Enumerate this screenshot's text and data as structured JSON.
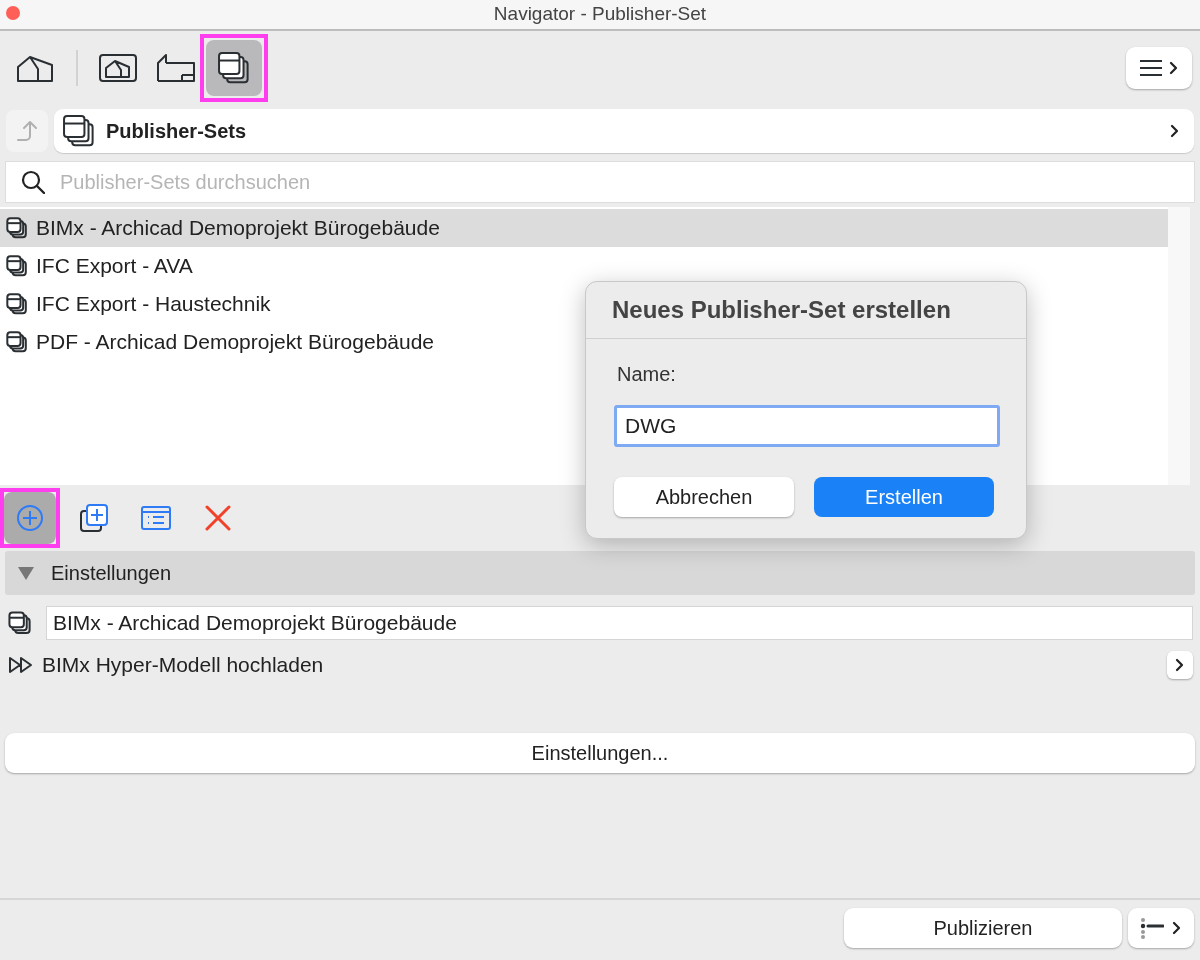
{
  "window": {
    "title": "Navigator - Publisher-Set"
  },
  "view_tabs": [
    {
      "kind": "project",
      "selected": false,
      "highlighted": false
    },
    {
      "kind": "view",
      "selected": false,
      "highlighted": false
    },
    {
      "kind": "layout",
      "selected": false,
      "highlighted": false
    },
    {
      "kind": "publisher",
      "selected": true,
      "highlighted": true
    }
  ],
  "path_bar": {
    "title": "Publisher-Sets"
  },
  "search": {
    "placeholder": "Publisher-Sets durchsuchen"
  },
  "sets": [
    {
      "label": "BIMx - Archicad Demoprojekt Bürogebäude",
      "selected": true
    },
    {
      "label": "IFC Export - AVA",
      "selected": false
    },
    {
      "label": "IFC Export - Haustechnik",
      "selected": false
    },
    {
      "label": "PDF - Archicad Demoprojekt Bürogebäude",
      "selected": false
    }
  ],
  "actions": [
    {
      "kind": "new",
      "highlighted": true
    },
    {
      "kind": "duplicate",
      "highlighted": false
    },
    {
      "kind": "properties",
      "highlighted": false
    },
    {
      "kind": "delete",
      "highlighted": false
    }
  ],
  "settings": {
    "heading": "Einstellungen",
    "expanded": true,
    "name_value": "BIMx - Archicad Demoprojekt Bürogebäude",
    "format": "BIMx Hyper-Modell hochladen",
    "button": "Einstellungen..."
  },
  "publish_button": "Publizieren",
  "dialog": {
    "title": "Neues Publisher-Set erstellen",
    "name_label": "Name:",
    "name_value": "DWG",
    "buttons": [
      {
        "label": "Abbrechen",
        "kind": "cancel"
      },
      {
        "label": "Erstellen",
        "kind": "default"
      }
    ]
  }
}
